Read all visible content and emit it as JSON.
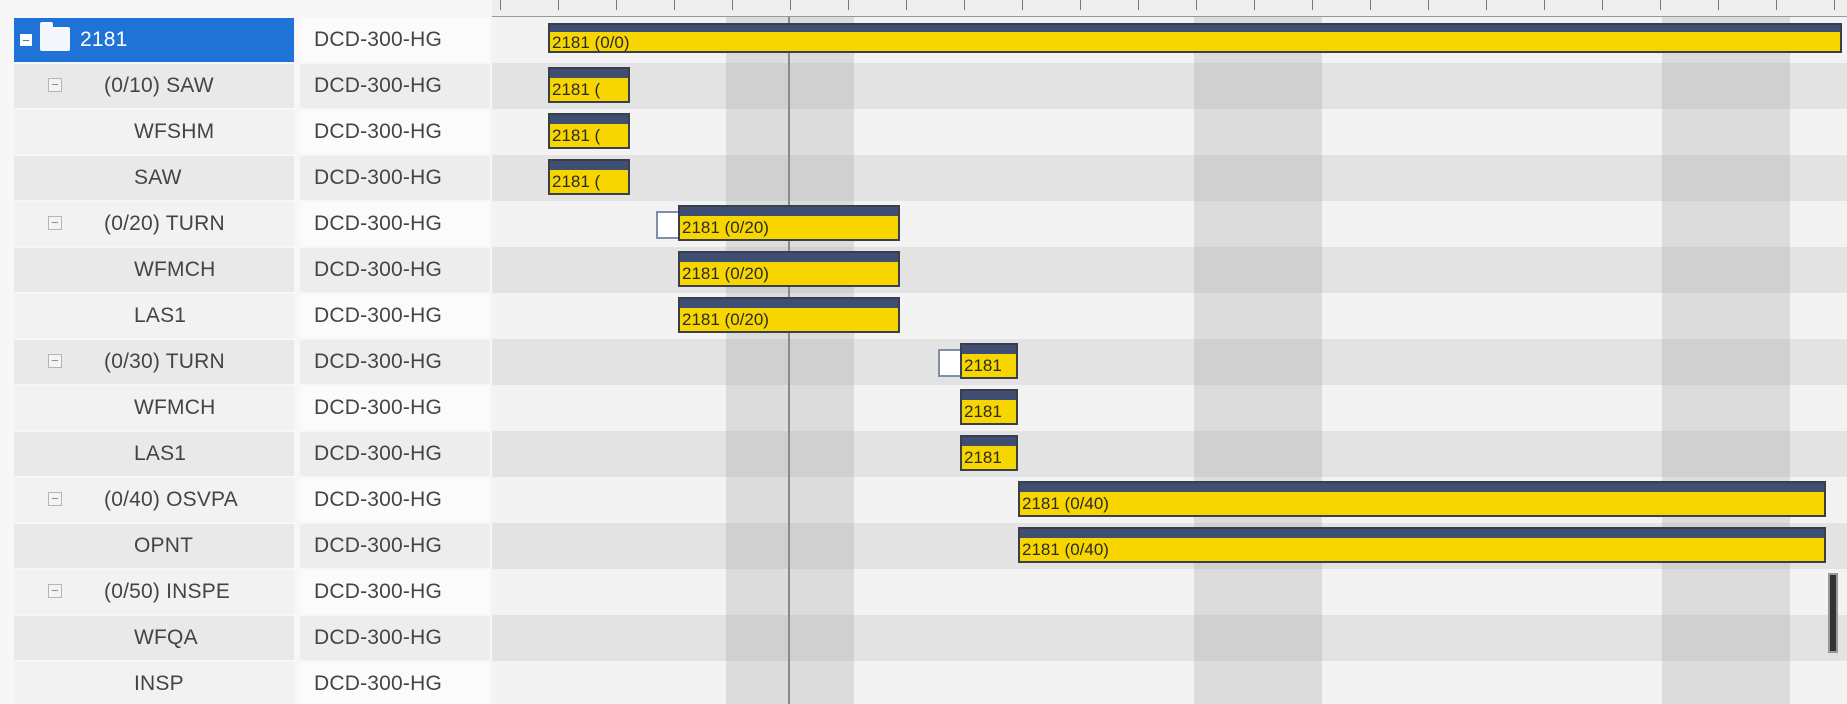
{
  "grid": {
    "rows": [
      {
        "kind": "root",
        "label": "2181",
        "resource": "DCD-300-HG",
        "selected": true
      },
      {
        "kind": "group",
        "label": "(0/10) SAW",
        "resource": "DCD-300-HG"
      },
      {
        "kind": "child",
        "label": "WFSHM",
        "resource": "DCD-300-HG"
      },
      {
        "kind": "child",
        "label": "SAW",
        "resource": "DCD-300-HG"
      },
      {
        "kind": "group",
        "label": "(0/20) TURN",
        "resource": "DCD-300-HG"
      },
      {
        "kind": "child",
        "label": "WFMCH",
        "resource": "DCD-300-HG"
      },
      {
        "kind": "child",
        "label": "LAS1",
        "resource": "DCD-300-HG"
      },
      {
        "kind": "group",
        "label": "(0/30) TURN",
        "resource": "DCD-300-HG"
      },
      {
        "kind": "child",
        "label": "WFMCH",
        "resource": "DCD-300-HG"
      },
      {
        "kind": "child",
        "label": "LAS1",
        "resource": "DCD-300-HG"
      },
      {
        "kind": "group",
        "label": "(0/40) OSVPA",
        "resource": "DCD-300-HG"
      },
      {
        "kind": "child",
        "label": "OPNT",
        "resource": "DCD-300-HG"
      },
      {
        "kind": "group",
        "label": "(0/50) INSPE",
        "resource": "DCD-300-HG"
      },
      {
        "kind": "child",
        "label": "WFQA",
        "resource": "DCD-300-HG"
      },
      {
        "kind": "child",
        "label": "INSP",
        "resource": "DCD-300-HG"
      }
    ]
  },
  "gantt": {
    "bars": [
      {
        "row": 0,
        "label": "2181 (0/0)",
        "summary": true
      },
      {
        "row": 1,
        "label": "2181 ("
      },
      {
        "row": 2,
        "label": "2181 ("
      },
      {
        "row": 3,
        "label": "2181 ("
      },
      {
        "row": 4,
        "label": "2181 (0/20)"
      },
      {
        "row": 5,
        "label": "2181 (0/20)"
      },
      {
        "row": 6,
        "label": "2181 (0/20)"
      },
      {
        "row": 7,
        "label": "2181"
      },
      {
        "row": 8,
        "label": "2181"
      },
      {
        "row": 9,
        "label": "2181"
      },
      {
        "row": 10,
        "label": "2181 (0/40)"
      },
      {
        "row": 11,
        "label": "2181 (0/40)"
      }
    ]
  },
  "colors": {
    "selection": "#1f73d6",
    "bar_fill": "#f7d600",
    "bar_top": "#3e4f73"
  },
  "icons": {
    "expander": "minus-box-icon",
    "root": "folder-icon"
  }
}
